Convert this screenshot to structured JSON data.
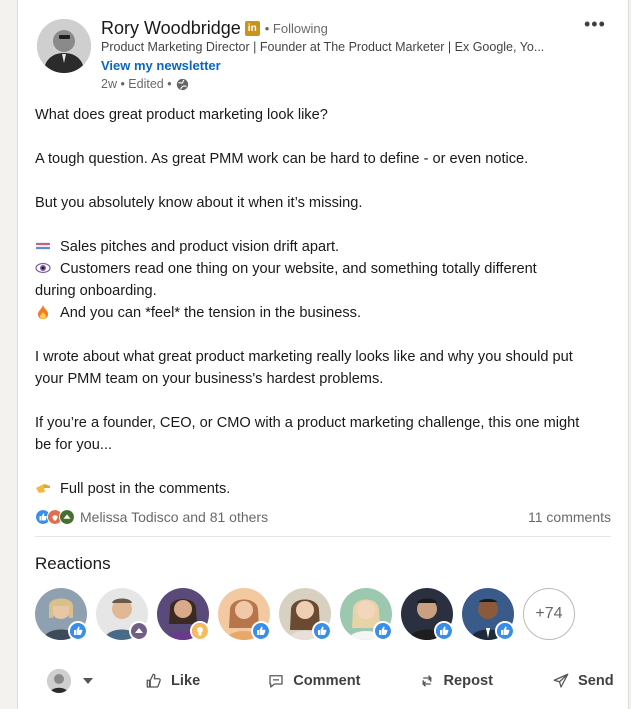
{
  "author": {
    "name": "Rory Woodbridge",
    "badge": "in",
    "follow_status": "• Following",
    "headline": "Product Marketing Director | Founder at The Product Marketer | Ex Google, Yo...",
    "newsletter_link": "View my newsletter",
    "meta": "2w • Edited •"
  },
  "post": {
    "p1": "What does great product marketing look like?",
    "p2": "A tough question. As great PMM work can be hard to define - or even notice.",
    "p3": "But you absolutely know about it when it’s missing.",
    "bullet1": "Sales pitches and product vision drift apart.",
    "bullet2a": "Customers read one thing on your website, and something totally different",
    "bullet2b": "during onboarding.",
    "bullet3": "And you can *feel* the tension in the business.",
    "p4a": "I wrote about what great product marketing really looks like and why you should put",
    "p4b": "your PMM team on your business's hardest problems.",
    "p5a": "If you’re a founder, CEO, or CMO with a product marketing challenge, this one might",
    "p5b": "be for you...",
    "p6": "Full post in the comments."
  },
  "social": {
    "reactors": "Melissa Todisco and 81 others",
    "comments": "11 comments"
  },
  "reactions": {
    "title": "Reactions",
    "more_count": "+74"
  },
  "actions": {
    "like": "Like",
    "comment": "Comment",
    "repost": "Repost",
    "send": "Send"
  },
  "colors": {
    "link": "#0a66c2",
    "like_blue": "#378fe9",
    "celebrate_green": "#44712e",
    "love_red": "#df704d",
    "insight_yellow": "#f5bb5c",
    "support_purple": "#715e86"
  }
}
